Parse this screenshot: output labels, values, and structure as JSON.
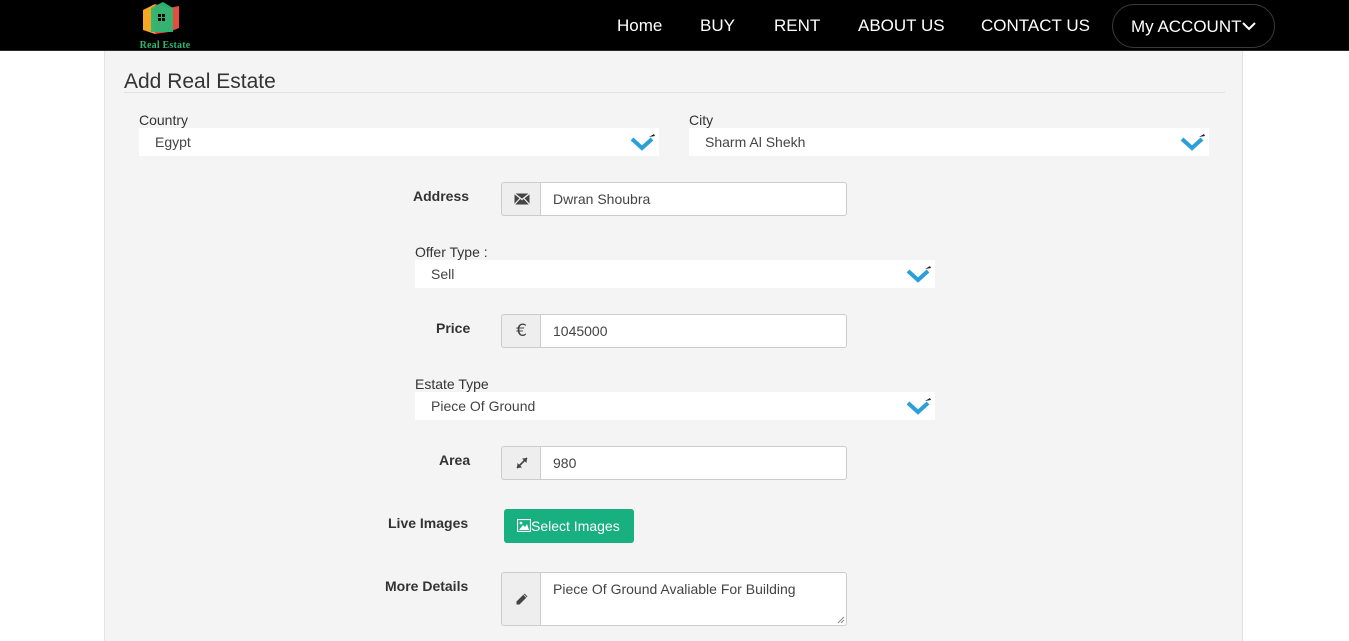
{
  "nav": {
    "logo_text": "Real Estate",
    "items": [
      "Home",
      "BUY",
      "RENT",
      "ABOUT US",
      "CONTACT US"
    ],
    "account_label": "My ACCOUNT"
  },
  "form": {
    "title": "Add Real Estate",
    "country": {
      "label": "Country",
      "value": "Egypt"
    },
    "city": {
      "label": "City",
      "value": "Sharm Al Shekh"
    },
    "address": {
      "label": "Address",
      "value": "Dwran Shoubra",
      "icon": "envelope-icon"
    },
    "offer_type": {
      "label": "Offer Type :",
      "value": "Sell"
    },
    "price": {
      "label": "Price",
      "value": "1045000",
      "icon": "euro-icon",
      "glyph": "€"
    },
    "estate_type": {
      "label": "Estate Type",
      "value": "Piece Of Ground"
    },
    "area": {
      "label": "Area",
      "value": "980",
      "icon": "resize-arrows-icon"
    },
    "images": {
      "label": "Live Images",
      "button_label": "Select Images",
      "icon": "picture-icon"
    },
    "details": {
      "label": "More Details",
      "value": "Piece Of Ground Avaliable For Building",
      "icon": "pencil-icon"
    }
  },
  "colors": {
    "nav_bg": "#000000",
    "panel_bg": "#f4f4f4",
    "accent_green": "#18b07e",
    "chevron_blue": "#2b9fd9"
  }
}
